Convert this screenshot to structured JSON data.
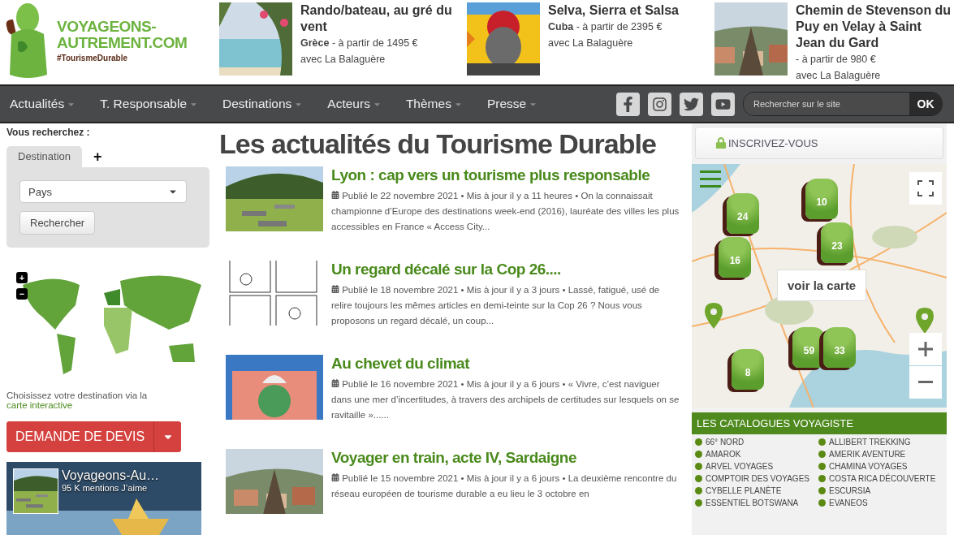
{
  "logo": {
    "line1": "VOYAGEONS-",
    "line2": "AUTREMENT.COM",
    "tagline": "#TourismeDurable"
  },
  "promos": [
    {
      "title": "Rando/bateau, au gré du vent",
      "line": "**Grèce** - à partir de 1495 €",
      "operator": "avec La Balaguère"
    },
    {
      "title": "Selva, Sierra et Salsa",
      "line": "**Cuba** - à partir de 2395 €",
      "operator": "avec La Balaguère"
    },
    {
      "title": "Chemin de Stevenson du Puy en Velay à Saint Jean du Gard",
      "line": " - à partir de 980 €",
      "operator": "avec La Balaguère"
    }
  ],
  "nav": {
    "items": [
      "Actualités",
      "T. Responsable",
      "Destinations",
      "Acteurs",
      "Thèmes",
      "Presse"
    ],
    "search": {
      "placeholder": "Rechercher sur le site",
      "button": "OK"
    }
  },
  "search_panel": {
    "heading": "Vous recherchez :",
    "tabs": [
      {
        "label": "Destination",
        "selected": true
      },
      {
        "label": "+",
        "selected": false
      }
    ],
    "select": "Pays",
    "button": "Rechercher",
    "map_zoom": [
      "+",
      "−"
    ],
    "caption": "Choisissez votre destination via la",
    "caption_link": "carte interactive"
  },
  "quote_button": {
    "label": "DEMANDE DE DEVIS"
  },
  "facebook": {
    "name": "Voyageons-Au…",
    "likes": "95 K mentions J’aime"
  },
  "main": {
    "title": "Les actualités du Tourisme Durable",
    "articles": [
      {
        "title": "Lyon : cap vers un tourisme plus responsable",
        "meta": "Publié le 22 novembre 2021 • Mis à jour il y a 11 heures •",
        "excerpt": "On la connaissait championne d’Europe des destinations week-end (2016), lauréate des villes les plus accessibles en France « Access City..."
      },
      {
        "title": "Un regard décalé sur la Cop 26....",
        "meta": "Publié le 18 novembre 2021 • Mis à jour il y a 3 jours •",
        "excerpt": "Lassé, fatigué, usé de relire toujours les mêmes articles en demi-teinte sur la Cop 26 ? Nous vous proposons un regard décalé, un coup..."
      },
      {
        "title": "Au chevet du climat",
        "meta": "Publié le 16 novembre 2021 • Mis à jour il y a 6 jours •",
        "excerpt": "« Vivre, c’est naviguer dans une mer d’incertitudes, à travers des archipels de certitudes sur lesquels on se ravitaille »......"
      },
      {
        "title": "Voyager en train, acte IV, Sardaigne",
        "meta": "Publié le 15 novembre 2021 • Mis à jour il y a 6 jours •",
        "excerpt": "La deuxième rencontre du réseau européen de tourisme durable a eu lieu le 3 octobre en"
      }
    ]
  },
  "signup": {
    "label": "INSCRIVEZ-VOUS"
  },
  "map": {
    "button": "voir la carte",
    "clusters": [
      "24",
      "10",
      "23",
      "16",
      "59",
      "33",
      "8"
    ]
  },
  "catalogues": {
    "title": "LES CATALOGUES VOYAGISTE",
    "items": [
      "66° NORD",
      "ALLIBERT TREKKING",
      "AMAROK",
      "AMERIK AVENTURE",
      "ARVEL VOYAGES",
      "CHAMINA VOYAGES",
      "COMPTOIR DES VOYAGES",
      "COSTA RICA DÉCOUVERTE",
      "CYBELLE PLANÈTE",
      "ESCURSIA",
      "ESSENTIEL BOTSWANA",
      "EVANEOS"
    ]
  }
}
